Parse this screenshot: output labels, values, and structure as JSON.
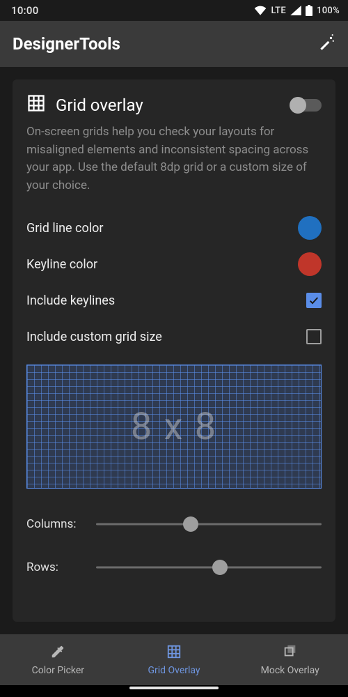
{
  "status": {
    "time": "10:00",
    "network": "LTE",
    "battery": "100%"
  },
  "appbar": {
    "title": "DesignerTools"
  },
  "grid_overlay": {
    "title": "Grid overlay",
    "enabled": false,
    "description": "On-screen grids help you check your layouts for misaligned elements and inconsistent spacing across your app. Use the default 8dp grid or a custom size of your choice.",
    "rows": [
      {
        "label": "Grid line color",
        "color": "#2070c0"
      },
      {
        "label": "Keyline color",
        "color": "#c0362a"
      },
      {
        "label": "Include keylines",
        "checked": true
      },
      {
        "label": "Include custom grid size",
        "checked": false
      }
    ],
    "preview_label": "8 x 8",
    "sliders": {
      "columns_label": "Columns:",
      "rows_label": "Rows:",
      "columns_value": 8,
      "rows_value": 8
    }
  },
  "bottom_nav": {
    "tabs": [
      {
        "label": "Color Picker",
        "icon": "eyedropper-icon",
        "active": false
      },
      {
        "label": "Grid Overlay",
        "icon": "grid-icon",
        "active": true
      },
      {
        "label": "Mock Overlay",
        "icon": "overlay-icon",
        "active": false
      }
    ]
  }
}
